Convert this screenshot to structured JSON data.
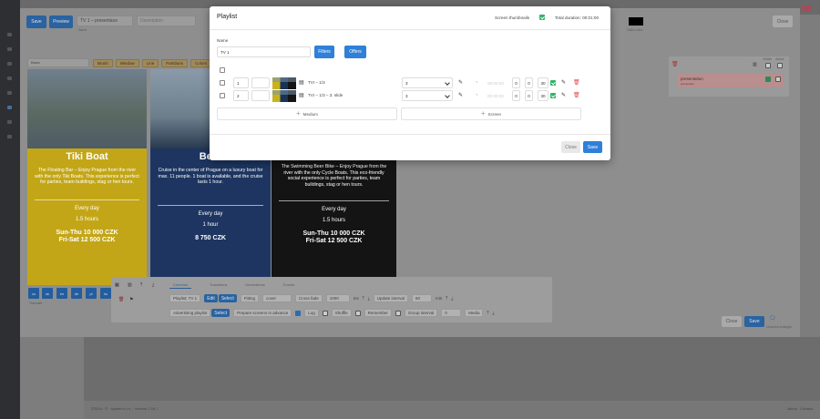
{
  "background": {
    "footer_left": "©2024 · © · system s.r.o. · Version 2.18.7",
    "footer_right_1": "About",
    "footer_right_2": "Contact"
  },
  "editor": {
    "name_value": "TV 1 – presentace",
    "name_label": "Name",
    "description_placeholder": "Description",
    "modal_close_label": "Close",
    "toolbar": {
      "save_label": "Save",
      "preview_label": "Preview",
      "basic_value": "Basic",
      "tools": [
        "Brush",
        "Window",
        "Line",
        "Partitions",
        "Colors"
      ]
    },
    "cards": [
      {
        "title": "Tiki Boat",
        "desc": "The Floating Bar – Enjoy Prague from the river with the only Tiki Boats. This experience is perfect for parties, team buildings, stag or hen tours.",
        "when": "Every day",
        "duration": "1.5 hours",
        "price1": "Sun-Thu 10 000 CZK",
        "price2": "Fri-Sat 12 500 CZK",
        "bg": "#c3a617",
        "fg": "#ffffff"
      },
      {
        "title": "Beer",
        "desc": "Cruise in the center of Prague on a luxury boat for max. 11 people. 1 boat is available, and the cruise lasts 1 hour.",
        "when": "Every day",
        "duration": "1 hour",
        "price1": "8 750 CZK",
        "price2": "",
        "bg": "#1d3560",
        "fg": "#ffffff"
      },
      {
        "title": "",
        "desc": "The Swimming Beer Bike – Enjoy Prague from the river with the only Cycle Boats. This eco-friendly social experience is perfect for parties, team buildings, stag or hen tours.",
        "when": "Every day",
        "duration": "1.5 hours",
        "price1": "Sun-Thu 10 000 CZK",
        "price2": "Fri-Sat 12 500 CZK",
        "bg": "#141414",
        "fg": "#ffffff"
      }
    ],
    "langs": [
      "cs",
      "sk",
      "en",
      "de",
      "pl",
      "hu"
    ],
    "lang_label": "Translate",
    "settings": {
      "tabs": [
        "Common",
        "Transitions",
        "Generations",
        "Events"
      ],
      "playlist_label": "Playlist: TV 1",
      "edit_label": "Edit",
      "select_label": "Select",
      "fitting_label": "Fitting",
      "fitting_value": "cover",
      "crossfade_label": "Cross fade",
      "crossfade_value": "1000",
      "ms_label": "ms",
      "update_label": "Update interval",
      "update_value": "60",
      "min_label": "min",
      "adv_label": "Advertising playlist",
      "prepare_label": "Prepare screens in advance",
      "log_label": "Log",
      "shuffle_label": "Shuffle",
      "remember_label": "Remember",
      "group_label": "Group interval",
      "group_value": "0",
      "media_label": "Media"
    },
    "right": {
      "label_a": "Visible",
      "label_b": "Active",
      "item": "presentation",
      "item_sub": "presentace",
      "close": "Close",
      "save": "Save",
      "unsaved": "Unsaved changes"
    },
    "video_label": "Video color"
  },
  "modal": {
    "title": "Playlist",
    "screen_thumbnails_label": "Screen thumbnails",
    "total_label": "Total duration: 00:01:00",
    "name_label": "Name",
    "name_value": "TV 1",
    "filters_label": "Filters",
    "offers_label": "Offers",
    "rows": [
      {
        "order": "1",
        "name": "TVI – 1/3",
        "select": "3",
        "time": "00:00:00",
        "h": "0",
        "m": "0",
        "s": "30"
      },
      {
        "order": "2",
        "name": "TVI – 1/3 – 3. slide",
        "select": "3",
        "time": "00:00:00",
        "h": "0",
        "m": "0",
        "s": "30"
      }
    ],
    "add_medium": "Medium",
    "add_screen": "Screen",
    "close_label": "Close",
    "save_label": "Save",
    "colors": {
      "accent": "#3a8ee6",
      "green": "#2fb36a",
      "danger": "#e5484d"
    }
  }
}
